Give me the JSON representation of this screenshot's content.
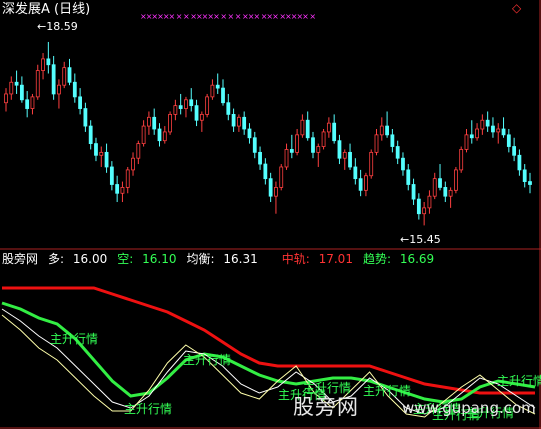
{
  "chart_data": [
    {
      "type": "candlestick",
      "title": "深发展A (日线)",
      "corner_symbol": "◇",
      "annotations": {
        "high": "←18.59",
        "low": "←15.45"
      },
      "ylim": [
        15.2,
        19.0
      ],
      "signal_markers": "××××××  ×  ×  ×××××  ×  ×  ×  ×××  ×××  ×××××  ×",
      "colors": {
        "up": "#ff4040",
        "down": "#55ffff",
        "marker": "#ff33ff"
      },
      "candles": [
        [
          17.55,
          17.8,
          17.4,
          17.7
        ],
        [
          17.7,
          18.0,
          17.6,
          17.9
        ],
        [
          17.9,
          18.1,
          17.7,
          17.85
        ],
        [
          17.85,
          18.0,
          17.55,
          17.6
        ],
        [
          17.6,
          17.75,
          17.3,
          17.45
        ],
        [
          17.45,
          17.7,
          17.35,
          17.65
        ],
        [
          17.65,
          18.2,
          17.6,
          18.1
        ],
        [
          18.1,
          18.4,
          17.95,
          18.3
        ],
        [
          18.3,
          18.59,
          18.05,
          18.2
        ],
        [
          18.2,
          18.35,
          17.6,
          17.7
        ],
        [
          17.7,
          17.95,
          17.45,
          17.85
        ],
        [
          17.85,
          18.25,
          17.8,
          18.15
        ],
        [
          18.15,
          18.3,
          17.85,
          17.9
        ],
        [
          17.9,
          18.05,
          17.55,
          17.65
        ],
        [
          17.65,
          17.8,
          17.35,
          17.45
        ],
        [
          17.45,
          17.55,
          17.05,
          17.15
        ],
        [
          17.15,
          17.25,
          16.75,
          16.85
        ],
        [
          16.85,
          16.95,
          16.55,
          16.65
        ],
        [
          16.65,
          16.8,
          16.45,
          16.7
        ],
        [
          16.7,
          16.85,
          16.35,
          16.45
        ],
        [
          16.45,
          16.55,
          16.05,
          16.15
        ],
        [
          16.15,
          16.3,
          15.85,
          16.0
        ],
        [
          16.0,
          16.2,
          15.85,
          16.1
        ],
        [
          16.1,
          16.45,
          16.0,
          16.4
        ],
        [
          16.4,
          16.7,
          16.3,
          16.6
        ],
        [
          16.6,
          16.9,
          16.5,
          16.85
        ],
        [
          16.85,
          17.25,
          16.8,
          17.15
        ],
        [
          17.15,
          17.4,
          17.0,
          17.3
        ],
        [
          17.3,
          17.45,
          17.0,
          17.1
        ],
        [
          17.1,
          17.2,
          16.8,
          16.9
        ],
        [
          16.9,
          17.15,
          16.85,
          17.05
        ],
        [
          17.05,
          17.4,
          17.0,
          17.35
        ],
        [
          17.35,
          17.6,
          17.25,
          17.5
        ],
        [
          17.5,
          17.7,
          17.35,
          17.45
        ],
        [
          17.45,
          17.65,
          17.3,
          17.6
        ],
        [
          17.6,
          17.8,
          17.4,
          17.5
        ],
        [
          17.5,
          17.6,
          17.15,
          17.25
        ],
        [
          17.25,
          17.4,
          17.05,
          17.35
        ],
        [
          17.35,
          17.7,
          17.3,
          17.65
        ],
        [
          17.65,
          17.95,
          17.6,
          17.85
        ],
        [
          17.85,
          18.05,
          17.7,
          17.8
        ],
        [
          17.8,
          17.95,
          17.5,
          17.55
        ],
        [
          17.55,
          17.7,
          17.25,
          17.35
        ],
        [
          17.35,
          17.45,
          17.05,
          17.15
        ],
        [
          17.15,
          17.35,
          17.05,
          17.3
        ],
        [
          17.3,
          17.4,
          17.0,
          17.1
        ],
        [
          17.1,
          17.2,
          16.85,
          16.95
        ],
        [
          16.95,
          17.05,
          16.6,
          16.7
        ],
        [
          16.7,
          16.8,
          16.4,
          16.5
        ],
        [
          16.5,
          16.6,
          16.15,
          16.25
        ],
        [
          16.25,
          16.35,
          15.85,
          15.95
        ],
        [
          15.95,
          16.2,
          15.65,
          16.1
        ],
        [
          16.1,
          16.5,
          16.05,
          16.45
        ],
        [
          16.45,
          16.85,
          16.4,
          16.75
        ],
        [
          16.75,
          17.0,
          16.6,
          16.7
        ],
        [
          16.7,
          17.1,
          16.65,
          17.0
        ],
        [
          17.0,
          17.35,
          16.95,
          17.25
        ],
        [
          17.25,
          17.4,
          16.9,
          16.95
        ],
        [
          16.95,
          17.05,
          16.6,
          16.7
        ],
        [
          16.7,
          16.85,
          16.45,
          16.8
        ],
        [
          16.8,
          17.1,
          16.75,
          17.05
        ],
        [
          17.05,
          17.3,
          16.95,
          17.2
        ],
        [
          17.2,
          17.35,
          16.85,
          16.9
        ],
        [
          16.9,
          17.0,
          16.5,
          16.6
        ],
        [
          16.6,
          16.75,
          16.4,
          16.7
        ],
        [
          16.7,
          16.85,
          16.4,
          16.45
        ],
        [
          16.45,
          16.6,
          16.15,
          16.25
        ],
        [
          16.25,
          16.4,
          15.95,
          16.05
        ],
        [
          16.05,
          16.35,
          15.95,
          16.3
        ],
        [
          16.3,
          16.75,
          16.25,
          16.7
        ],
        [
          16.7,
          17.1,
          16.65,
          17.0
        ],
        [
          17.0,
          17.3,
          16.9,
          17.15
        ],
        [
          17.15,
          17.4,
          16.95,
          17.0
        ],
        [
          17.0,
          17.1,
          16.7,
          16.8
        ],
        [
          16.8,
          16.9,
          16.5,
          16.6
        ],
        [
          16.6,
          16.7,
          16.3,
          16.4
        ],
        [
          16.4,
          16.5,
          16.05,
          16.15
        ],
        [
          16.15,
          16.25,
          15.8,
          15.9
        ],
        [
          15.9,
          16.0,
          15.55,
          15.65
        ],
        [
          15.65,
          15.85,
          15.45,
          15.75
        ],
        [
          15.75,
          16.05,
          15.65,
          15.95
        ],
        [
          15.95,
          16.35,
          15.9,
          16.25
        ],
        [
          16.25,
          16.5,
          16.05,
          16.1
        ],
        [
          16.1,
          16.2,
          15.85,
          15.95
        ],
        [
          15.95,
          16.1,
          15.75,
          16.05
        ],
        [
          16.05,
          16.45,
          16.0,
          16.4
        ],
        [
          16.4,
          16.8,
          16.35,
          16.75
        ],
        [
          16.75,
          17.1,
          16.7,
          17.0
        ],
        [
          17.0,
          17.25,
          16.85,
          16.95
        ],
        [
          16.95,
          17.2,
          16.9,
          17.1
        ],
        [
          17.1,
          17.35,
          17.0,
          17.25
        ],
        [
          17.25,
          17.4,
          17.05,
          17.15
        ],
        [
          17.15,
          17.3,
          16.95,
          17.05
        ],
        [
          17.05,
          17.2,
          16.85,
          17.1
        ],
        [
          17.1,
          17.3,
          16.95,
          17.0
        ],
        [
          17.0,
          17.1,
          16.7,
          16.8
        ],
        [
          16.8,
          16.95,
          16.55,
          16.65
        ],
        [
          16.65,
          16.75,
          16.3,
          16.4
        ],
        [
          16.4,
          16.5,
          16.1,
          16.2
        ],
        [
          16.2,
          16.35,
          16.0,
          16.15
        ]
      ]
    },
    {
      "type": "line",
      "indicator_values": [
        {
          "label": "股旁网",
          "color": "#ffffff"
        },
        {
          "label": "多:",
          "value": "16.00",
          "color": "#ffffff"
        },
        {
          "label": "空:",
          "value": "16.10",
          "color": "#33ff55"
        },
        {
          "label": "均衡:",
          "value": "16.31",
          "color": "#ffffff"
        },
        {
          "label": "中轨:",
          "value": "17.01",
          "color": "#ff3333"
        },
        {
          "label": "趋势:",
          "value": "16.69",
          "color": "#33ff55"
        }
      ],
      "ylim": [
        15.4,
        17.9
      ],
      "signal_label": "主升行情",
      "signal_bars": [
        10,
        34,
        30,
        70,
        77,
        89,
        94,
        106,
        110,
        128
      ],
      "series": [
        {
          "color": "#ee1111",
          "values": [
            17.6,
            17.6,
            17.6,
            17.6,
            17.6,
            17.6,
            17.5,
            17.4,
            17.3,
            17.2,
            17.05,
            16.9,
            16.7,
            16.5,
            16.35,
            16.3,
            16.3,
            16.3,
            16.3,
            16.3,
            16.3,
            16.2,
            16.1,
            16.0,
            15.95,
            15.9,
            15.85,
            15.85,
            15.85,
            15.85
          ]
        },
        {
          "color": "#33ee44",
          "values": [
            17.35,
            17.25,
            17.1,
            17.0,
            16.75,
            16.4,
            16.05,
            15.8,
            15.85,
            16.1,
            16.4,
            16.5,
            16.45,
            16.3,
            16.15,
            16.05,
            16.0,
            16.05,
            16.1,
            16.1,
            16.05,
            15.95,
            15.85,
            15.75,
            15.7,
            15.75,
            15.95,
            16.05,
            16.0,
            15.95
          ]
        },
        {
          "color": "#ffffff",
          "values": [
            17.25,
            17.05,
            16.8,
            16.6,
            16.3,
            16.0,
            15.7,
            15.6,
            15.8,
            16.2,
            16.55,
            16.5,
            16.3,
            16.0,
            15.85,
            15.95,
            16.2,
            16.0,
            15.7,
            15.8,
            16.1,
            15.9,
            15.6,
            15.5,
            15.6,
            15.85,
            16.1,
            16.0,
            15.8,
            15.6
          ]
        },
        {
          "color": "#ffffaa",
          "values": [
            17.15,
            16.9,
            16.6,
            16.4,
            16.1,
            15.8,
            15.55,
            15.55,
            15.9,
            16.35,
            16.65,
            16.45,
            16.15,
            15.85,
            15.75,
            16.05,
            16.3,
            15.85,
            15.6,
            15.9,
            16.2,
            15.8,
            15.5,
            15.45,
            15.7,
            15.95,
            16.15,
            15.9,
            15.65,
            15.5
          ]
        }
      ]
    }
  ],
  "watermark": {
    "main": "股旁网",
    "sub": "www.gupang.com"
  }
}
